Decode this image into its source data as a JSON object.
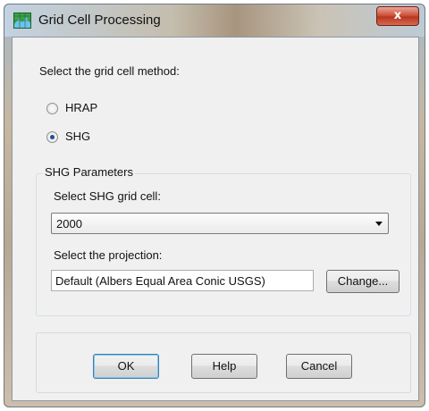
{
  "window": {
    "title": "Grid Cell Processing",
    "close_label": "x"
  },
  "method": {
    "prompt": "Select the grid cell method:",
    "options": [
      {
        "label": "HRAP",
        "selected": false
      },
      {
        "label": "SHG",
        "selected": true
      }
    ]
  },
  "shg_params": {
    "group_title": "SHG Parameters",
    "grid_cell_prompt": "Select SHG grid cell:",
    "grid_cell_value": "2000",
    "projection_prompt": "Select the projection:",
    "projection_value": "Default (Albers Equal Area Conic USGS)",
    "change_label_pre": "Chan",
    "change_label_underlined": "g",
    "change_label_post": "e..."
  },
  "buttons": {
    "ok": "OK",
    "help": "Help",
    "cancel": "Cancel"
  },
  "colors": {
    "radio_dot": "#1f4e9a",
    "close_button": "#c8452c"
  }
}
